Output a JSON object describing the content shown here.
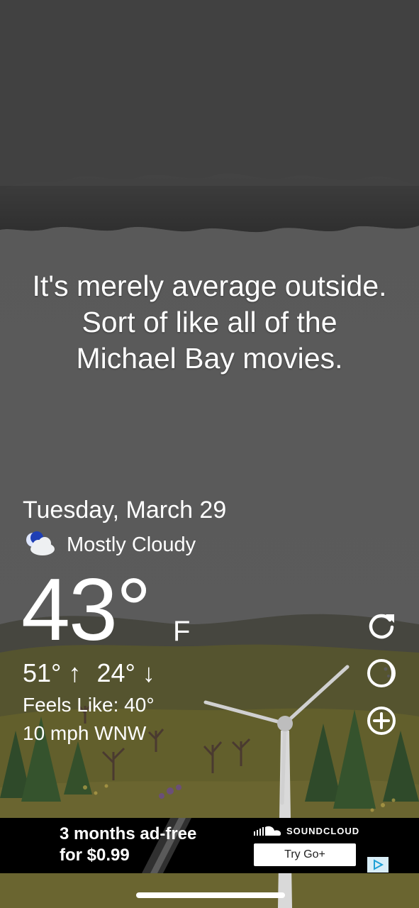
{
  "colors": {
    "sky": "#5a5a5a",
    "cloud": "#333333",
    "hill": "#47473f",
    "grass": "#5e5d2f",
    "ad_bg": "#000000",
    "text": "#ffffff"
  },
  "quip": {
    "line1": "It's merely average outside.",
    "line2": "Sort of like all of the",
    "line3": "Michael Bay movies."
  },
  "weather": {
    "date": "Tuesday, March 29",
    "condition_icon": "partly-cloudy-night-icon",
    "condition": "Mostly Cloudy",
    "temperature": "43°",
    "unit": "F",
    "high": "51°",
    "high_arrow": "↑",
    "low": "24°",
    "low_arrow": "↓",
    "feels_like": "Feels Like: 40°",
    "wind": "10 mph WNW"
  },
  "side_buttons": {
    "refresh": "refresh-icon",
    "theme": "moon-icon",
    "add": "add-circle-icon"
  },
  "ad": {
    "line1": "3 months ad-free",
    "line2": "for $0.99",
    "brand": "SOUNDCLOUD",
    "cta": "Try Go+",
    "choices_icon": "ad-choices-icon"
  }
}
